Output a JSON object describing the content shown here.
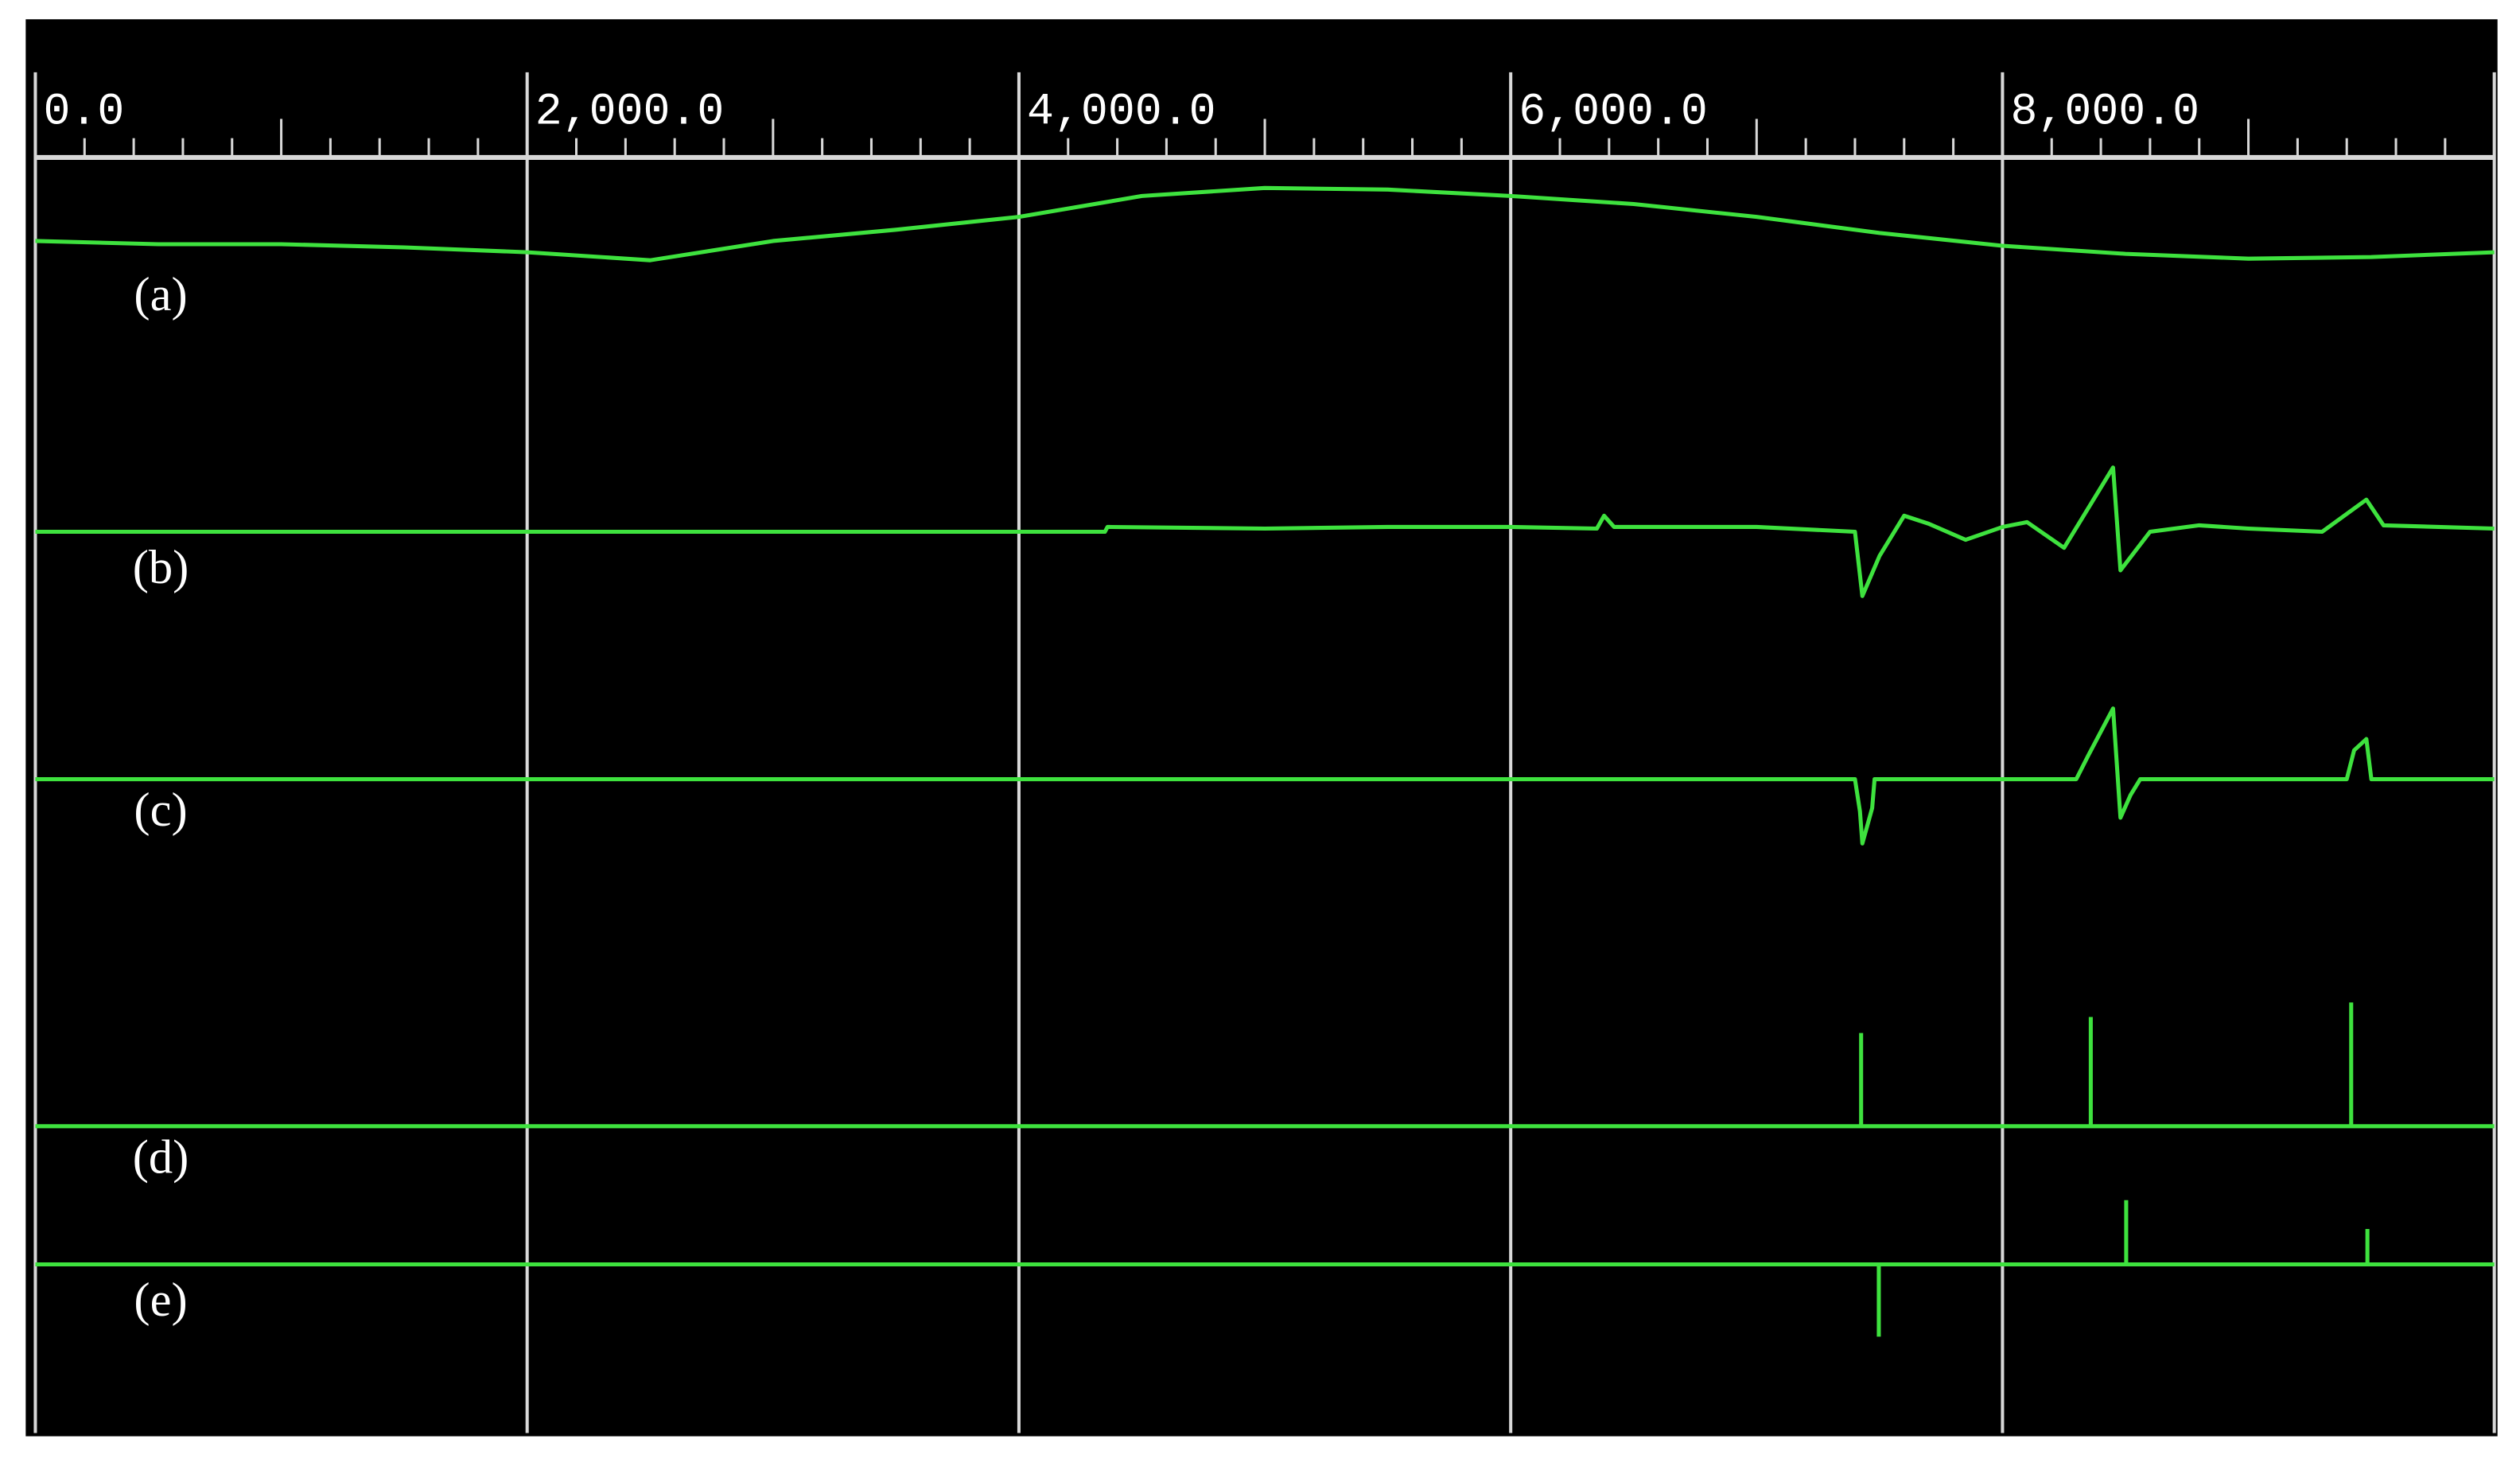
{
  "chart_data": {
    "type": "line",
    "title": "",
    "xlabel": "",
    "ylabel": "",
    "xlim": [
      0,
      10000
    ],
    "x_ticks": [
      0,
      2000,
      4000,
      6000,
      8000
    ],
    "x_tick_labels": [
      "0.0",
      "2,000.0",
      "4,000.0",
      "6,000.0",
      "8,000.0"
    ],
    "grid": true,
    "colors": {
      "background": "#000000",
      "trace": "#3ee23e",
      "grid": "#d8d8d8"
    },
    "amplitude_units": "arbitrary",
    "series": [
      {
        "name": "(a)",
        "points": [
          [
            0,
            5
          ],
          [
            500,
            3
          ],
          [
            1000,
            3
          ],
          [
            1500,
            1
          ],
          [
            2000,
            -2
          ],
          [
            2500,
            -7
          ],
          [
            3000,
            5
          ],
          [
            3500,
            12
          ],
          [
            4000,
            20
          ],
          [
            4500,
            33
          ],
          [
            5000,
            38
          ],
          [
            5500,
            37
          ],
          [
            6000,
            33
          ],
          [
            6500,
            28
          ],
          [
            7000,
            20
          ],
          [
            7500,
            10
          ],
          [
            8000,
            2
          ],
          [
            8500,
            -3
          ],
          [
            9000,
            -6
          ],
          [
            9500,
            -5
          ],
          [
            10000,
            -2
          ]
        ]
      },
      {
        "name": "(b)",
        "points": [
          [
            0,
            0
          ],
          [
            4350,
            0
          ],
          [
            4360,
            3
          ],
          [
            5000,
            2
          ],
          [
            5500,
            3
          ],
          [
            6000,
            3
          ],
          [
            6350,
            2
          ],
          [
            6380,
            10
          ],
          [
            6420,
            3
          ],
          [
            7000,
            3
          ],
          [
            7400,
            0
          ],
          [
            7430,
            -40
          ],
          [
            7500,
            -15
          ],
          [
            7600,
            10
          ],
          [
            7700,
            5
          ],
          [
            7850,
            -5
          ],
          [
            8000,
            3
          ],
          [
            8100,
            6
          ],
          [
            8250,
            -10
          ],
          [
            8450,
            40
          ],
          [
            8480,
            -24
          ],
          [
            8600,
            0
          ],
          [
            8800,
            4
          ],
          [
            9000,
            2
          ],
          [
            9300,
            0
          ],
          [
            9480,
            20
          ],
          [
            9550,
            4
          ],
          [
            10000,
            2
          ]
        ]
      },
      {
        "name": "(c)",
        "points": [
          [
            0,
            0
          ],
          [
            7400,
            0
          ],
          [
            7420,
            -20
          ],
          [
            7430,
            -40
          ],
          [
            7470,
            -18
          ],
          [
            7480,
            0
          ],
          [
            8300,
            0
          ],
          [
            8350,
            15
          ],
          [
            8450,
            44
          ],
          [
            8480,
            -24
          ],
          [
            8520,
            -10
          ],
          [
            8560,
            0
          ],
          [
            9400,
            0
          ],
          [
            9430,
            18
          ],
          [
            9480,
            25
          ],
          [
            9500,
            0
          ],
          [
            10000,
            0
          ]
        ]
      },
      {
        "name": "(d)",
        "spikes": [
          [
            7425,
            58
          ],
          [
            8359,
            68
          ],
          [
            9418,
            77
          ]
        ]
      },
      {
        "name": "(e)",
        "spikes": [
          [
            7497,
            -45
          ],
          [
            8503,
            40
          ],
          [
            9484,
            22
          ]
        ]
      }
    ]
  }
}
